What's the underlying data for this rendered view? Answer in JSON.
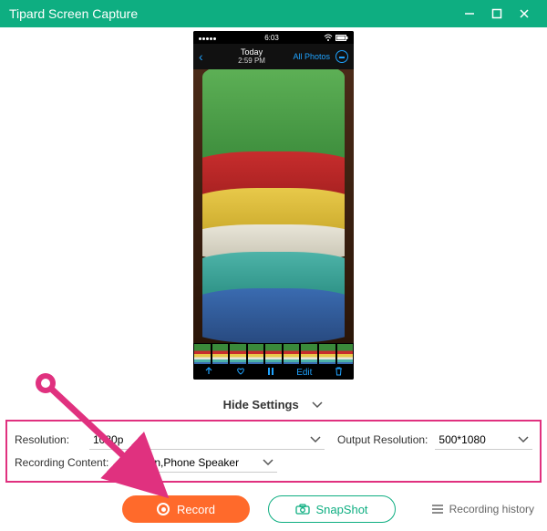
{
  "titlebar": {
    "title": "Tipard Screen Capture"
  },
  "phone": {
    "status": {
      "carrier": "",
      "time": "6:03"
    },
    "nav": {
      "today": "Today",
      "time": "2:59 PM",
      "all_photos": "All Photos"
    },
    "tools": {
      "edit": "Edit"
    }
  },
  "hide_settings": {
    "label": "Hide Settings"
  },
  "settings": {
    "resolution_label": "Resolution:",
    "resolution_value": "1080p",
    "output_label": "Output Resolution:",
    "output_value": "500*1080",
    "content_label": "Recording Content:",
    "content_value": "Screen,Phone Speaker"
  },
  "buttons": {
    "record": "Record",
    "snapshot": "SnapShot",
    "history": "Recording history"
  }
}
